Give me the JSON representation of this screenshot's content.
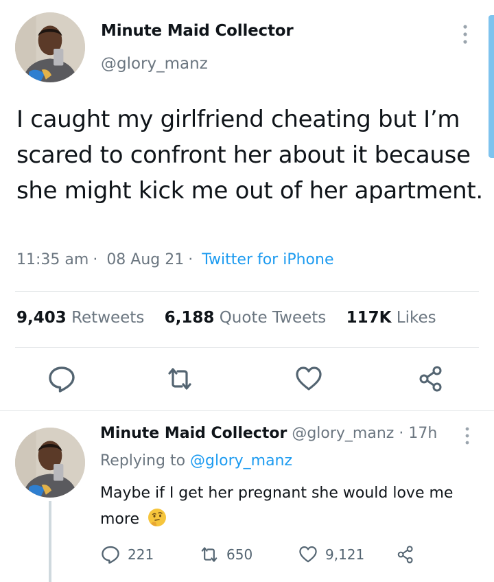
{
  "tweet": {
    "display_name": "Minute Maid Collector",
    "handle": "@glory_manz",
    "text": "I caught my girlfriend cheating but I’m scared to confront her about it because she might kick me out of her apartment.",
    "time": "11:35 am",
    "date": "08 Aug 21",
    "source": "Twitter for iPhone",
    "stats": {
      "retweets_count": "9,403",
      "retweets_label": "Retweets",
      "quotes_count": "6,188",
      "quotes_label": "Quote Tweets",
      "likes_count": "117K",
      "likes_label": "Likes"
    },
    "actions": [
      "reply-icon",
      "retweet-icon",
      "like-icon",
      "share-icon"
    ]
  },
  "reply": {
    "display_name": "Minute Maid Collector",
    "handle": "@glory_manz",
    "age": "17h",
    "replying_prefix": "Replying to",
    "replying_handle": "@glory_manz",
    "text": "Maybe if I get her pregnant she would love me more",
    "emoji": "thinking-face-icon",
    "counts": {
      "replies": "221",
      "retweets": "650",
      "likes": "9,121"
    }
  },
  "colors": {
    "link": "#1d9bf0",
    "muted": "#6b7680",
    "text": "#0f1419",
    "divider": "#e3e6e8"
  }
}
